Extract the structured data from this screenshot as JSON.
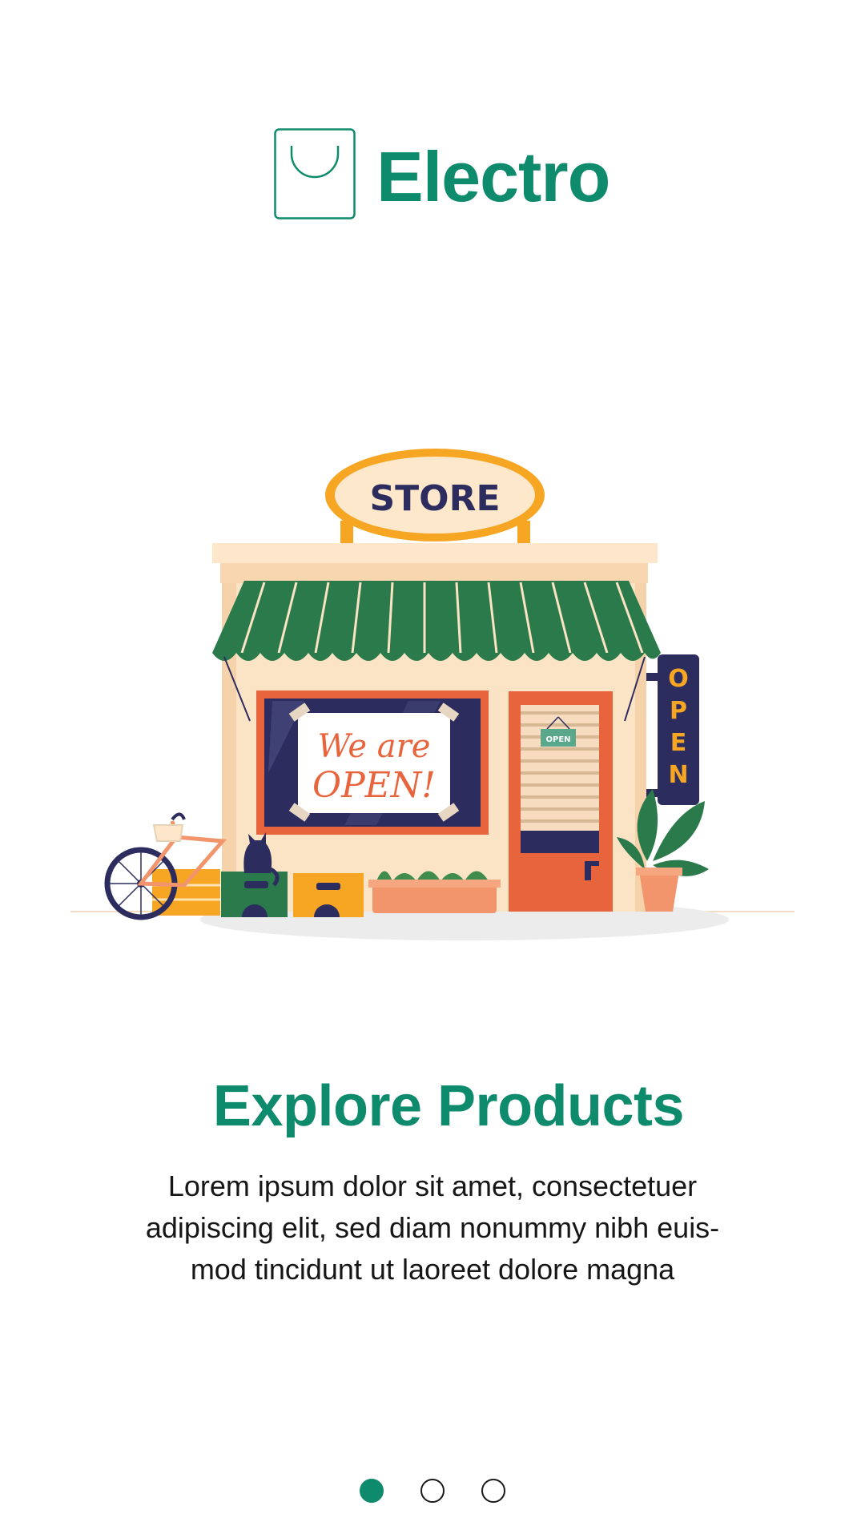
{
  "brand": {
    "name": "Electro",
    "color": "#0e8a6c",
    "icon": "shopping-bag-icon"
  },
  "illustration": {
    "store_sign": "STORE",
    "window_poster_line1": "We are",
    "window_poster_line2": "OPEN!",
    "door_sign": "OPEN",
    "hanging_sign_letters": [
      "O",
      "P",
      "E",
      "N"
    ]
  },
  "onboarding": {
    "title": "Explore Products",
    "description": "Lorem ipsum dolor sit amet, consectetuer adipiscing elit, sed diam nonummy nibh euis-mod tincidunt ut laoreet dolore magna"
  },
  "pagination": {
    "total": 3,
    "current": 1
  }
}
